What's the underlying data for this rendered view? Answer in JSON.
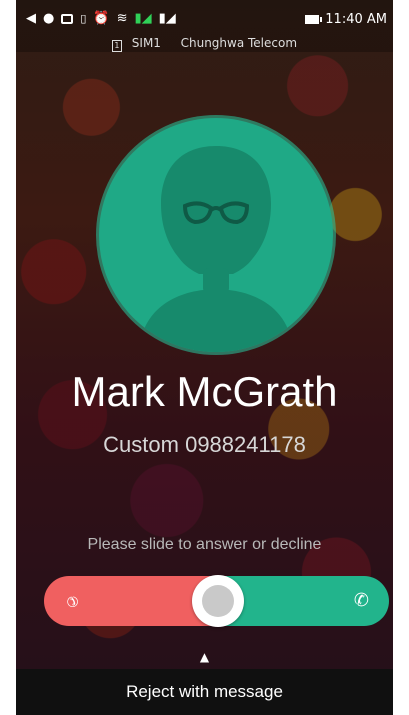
{
  "status_bar": {
    "time": "11:40 AM",
    "icons": [
      "back-icon",
      "person-icon",
      "image-icon",
      "sim-icon",
      "alarm-icon",
      "wifi-icon",
      "sim1-signal-icon",
      "sim2-signal-icon",
      "battery-icon"
    ],
    "sim_label": "SIM1",
    "carrier": "Chunghwa Telecom"
  },
  "caller": {
    "name": "Mark McGrath",
    "number": "Custom 0988241178"
  },
  "hint": "Please slide to answer or decline",
  "slider": {
    "decline_color": "#f06060",
    "answer_color": "#22b48c",
    "knob_position": 0.5
  },
  "reject_label": "Reject with message",
  "colors": {
    "avatar_bg": "#1fa986",
    "avatar_fg": "#178a6c"
  }
}
